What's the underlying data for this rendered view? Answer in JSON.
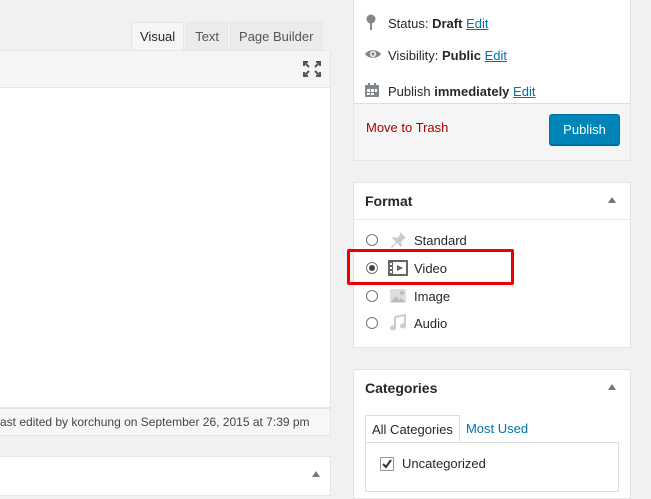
{
  "editor": {
    "tabs": [
      "Visual",
      "Text",
      "Page Builder"
    ],
    "active_tab": "Visual",
    "fullscreen_icon": "expand-icon",
    "last_edited": "ast edited by korchung on September 26, 2015 at 7:39 pm"
  },
  "publish": {
    "status_label": "Status:",
    "status_value": "Draft",
    "visibility_label": "Visibility:",
    "visibility_value": "Public",
    "publish_label": "Publish",
    "publish_value": "immediately",
    "edit_link": "Edit",
    "trash_label": "Move to Trash",
    "publish_button": "Publish"
  },
  "format": {
    "title": "Format",
    "options": [
      {
        "label": "Standard",
        "icon": "pushpin-icon",
        "selected": false
      },
      {
        "label": "Video",
        "icon": "video-icon",
        "selected": true
      },
      {
        "label": "Image",
        "icon": "image-icon",
        "selected": false
      },
      {
        "label": "Audio",
        "icon": "music-note-icon",
        "selected": false
      }
    ]
  },
  "categories": {
    "title": "Categories",
    "tabs": [
      "All Categories",
      "Most Used"
    ],
    "items": [
      {
        "label": "Uncategorized",
        "checked": true
      }
    ]
  },
  "colors": {
    "accent": "#0085ba",
    "link": "#0073aa",
    "trash": "#a00",
    "highlight": "#e00"
  }
}
